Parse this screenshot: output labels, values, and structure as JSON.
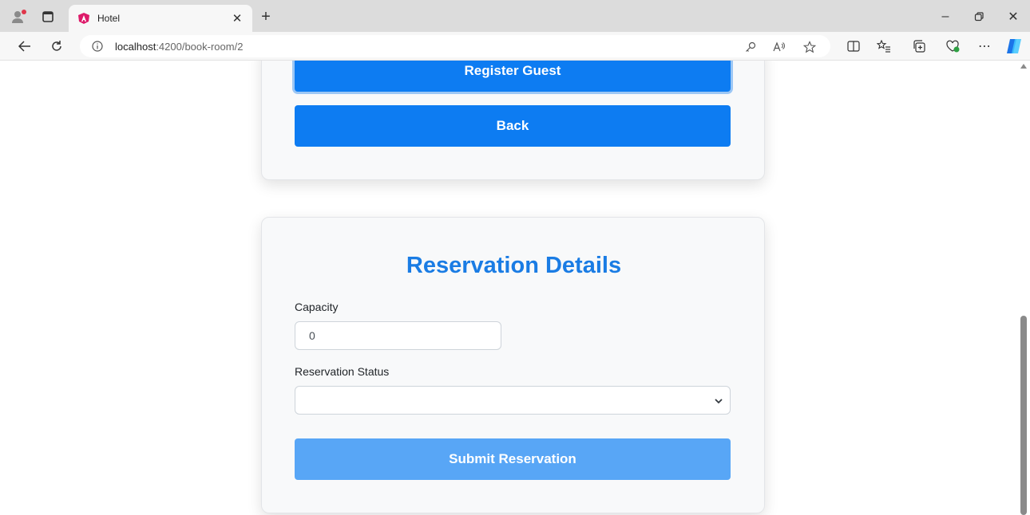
{
  "browser": {
    "tab_title": "Hotel",
    "url_host": "localhost",
    "url_rest": ":4200/book-room/2"
  },
  "guest_card": {
    "register_label": "Register Guest",
    "back_label": "Back"
  },
  "reservation": {
    "heading": "Reservation Details",
    "capacity_label": "Capacity",
    "capacity_value": "0",
    "status_label": "Reservation Status",
    "status_value": "",
    "submit_label": "Submit Reservation"
  },
  "colors": {
    "primary": "#0d7cf2",
    "primary_disabled": "#58a6f6",
    "heading": "#1a7ce4"
  }
}
